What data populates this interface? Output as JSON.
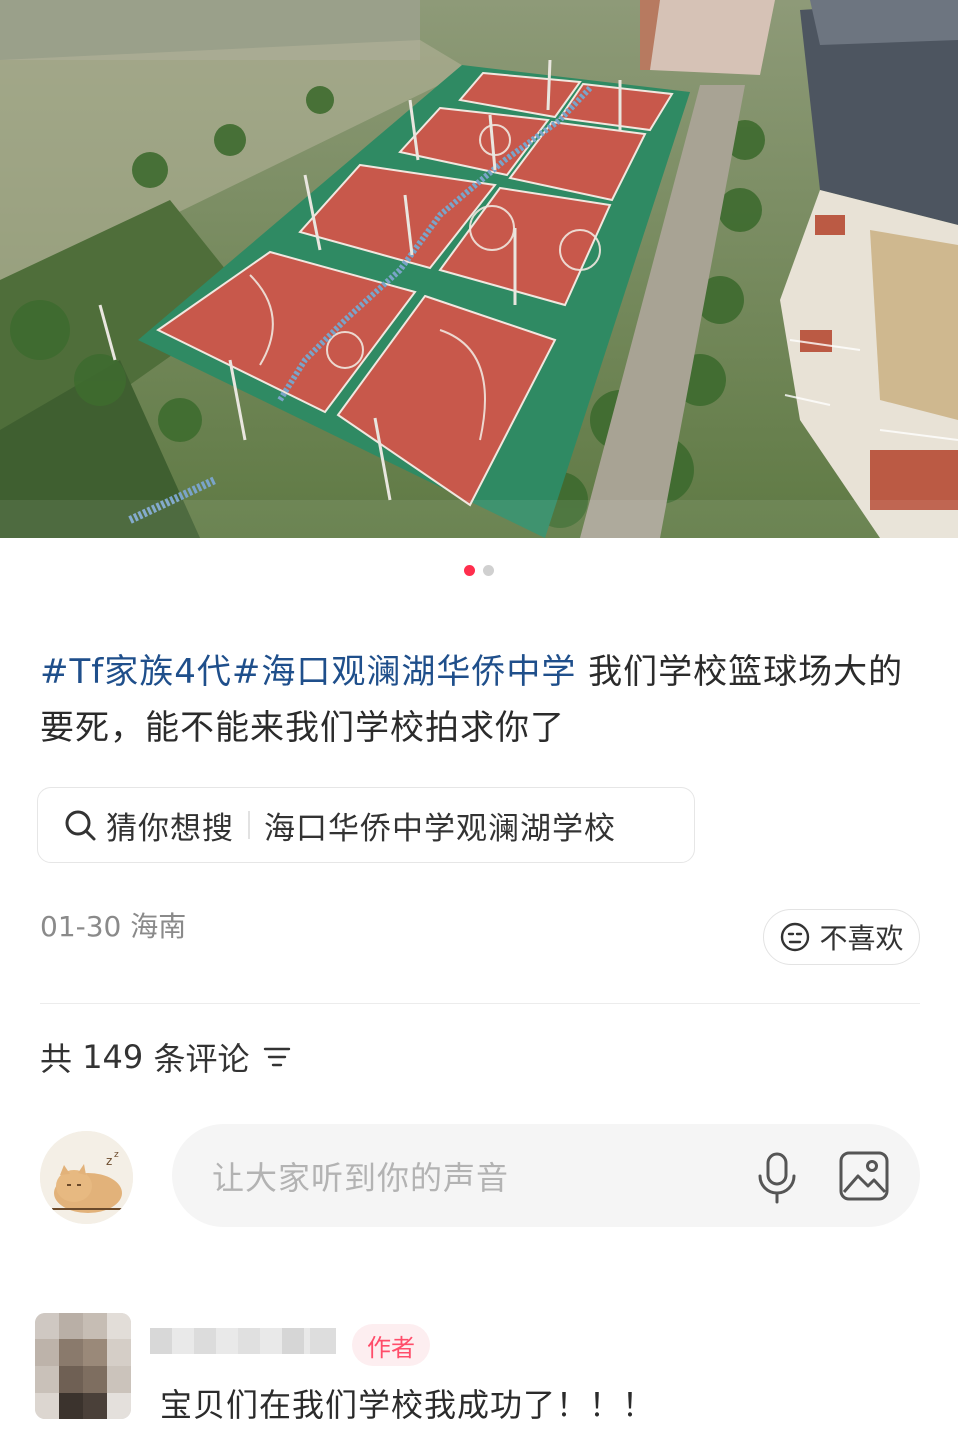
{
  "post": {
    "carousel": {
      "total": 2,
      "active": 1
    },
    "text_tags": "#Tf家族4代#海口观澜湖华侨中学",
    "text_body": " 我们学校篮球场大的要死，能不能来我们学校拍求你了",
    "guess_label": "猜你想搜",
    "guess_query": "海口华侨中学观澜湖学校",
    "date": "01-30",
    "location": "海南",
    "dislike_label": "不喜欢"
  },
  "comments": {
    "header_prefix": "共",
    "count": "149",
    "header_suffix": "条评论",
    "input_placeholder": "让大家听到你的声音",
    "items": [
      {
        "badge": "作者",
        "text": "宝贝们在我们学校我成功了！！！"
      }
    ]
  },
  "colors": {
    "hashtag": "#1f4f8b",
    "accent": "#ff2e4d",
    "court": "#c8584b",
    "court_surround": "#2f8a63"
  }
}
